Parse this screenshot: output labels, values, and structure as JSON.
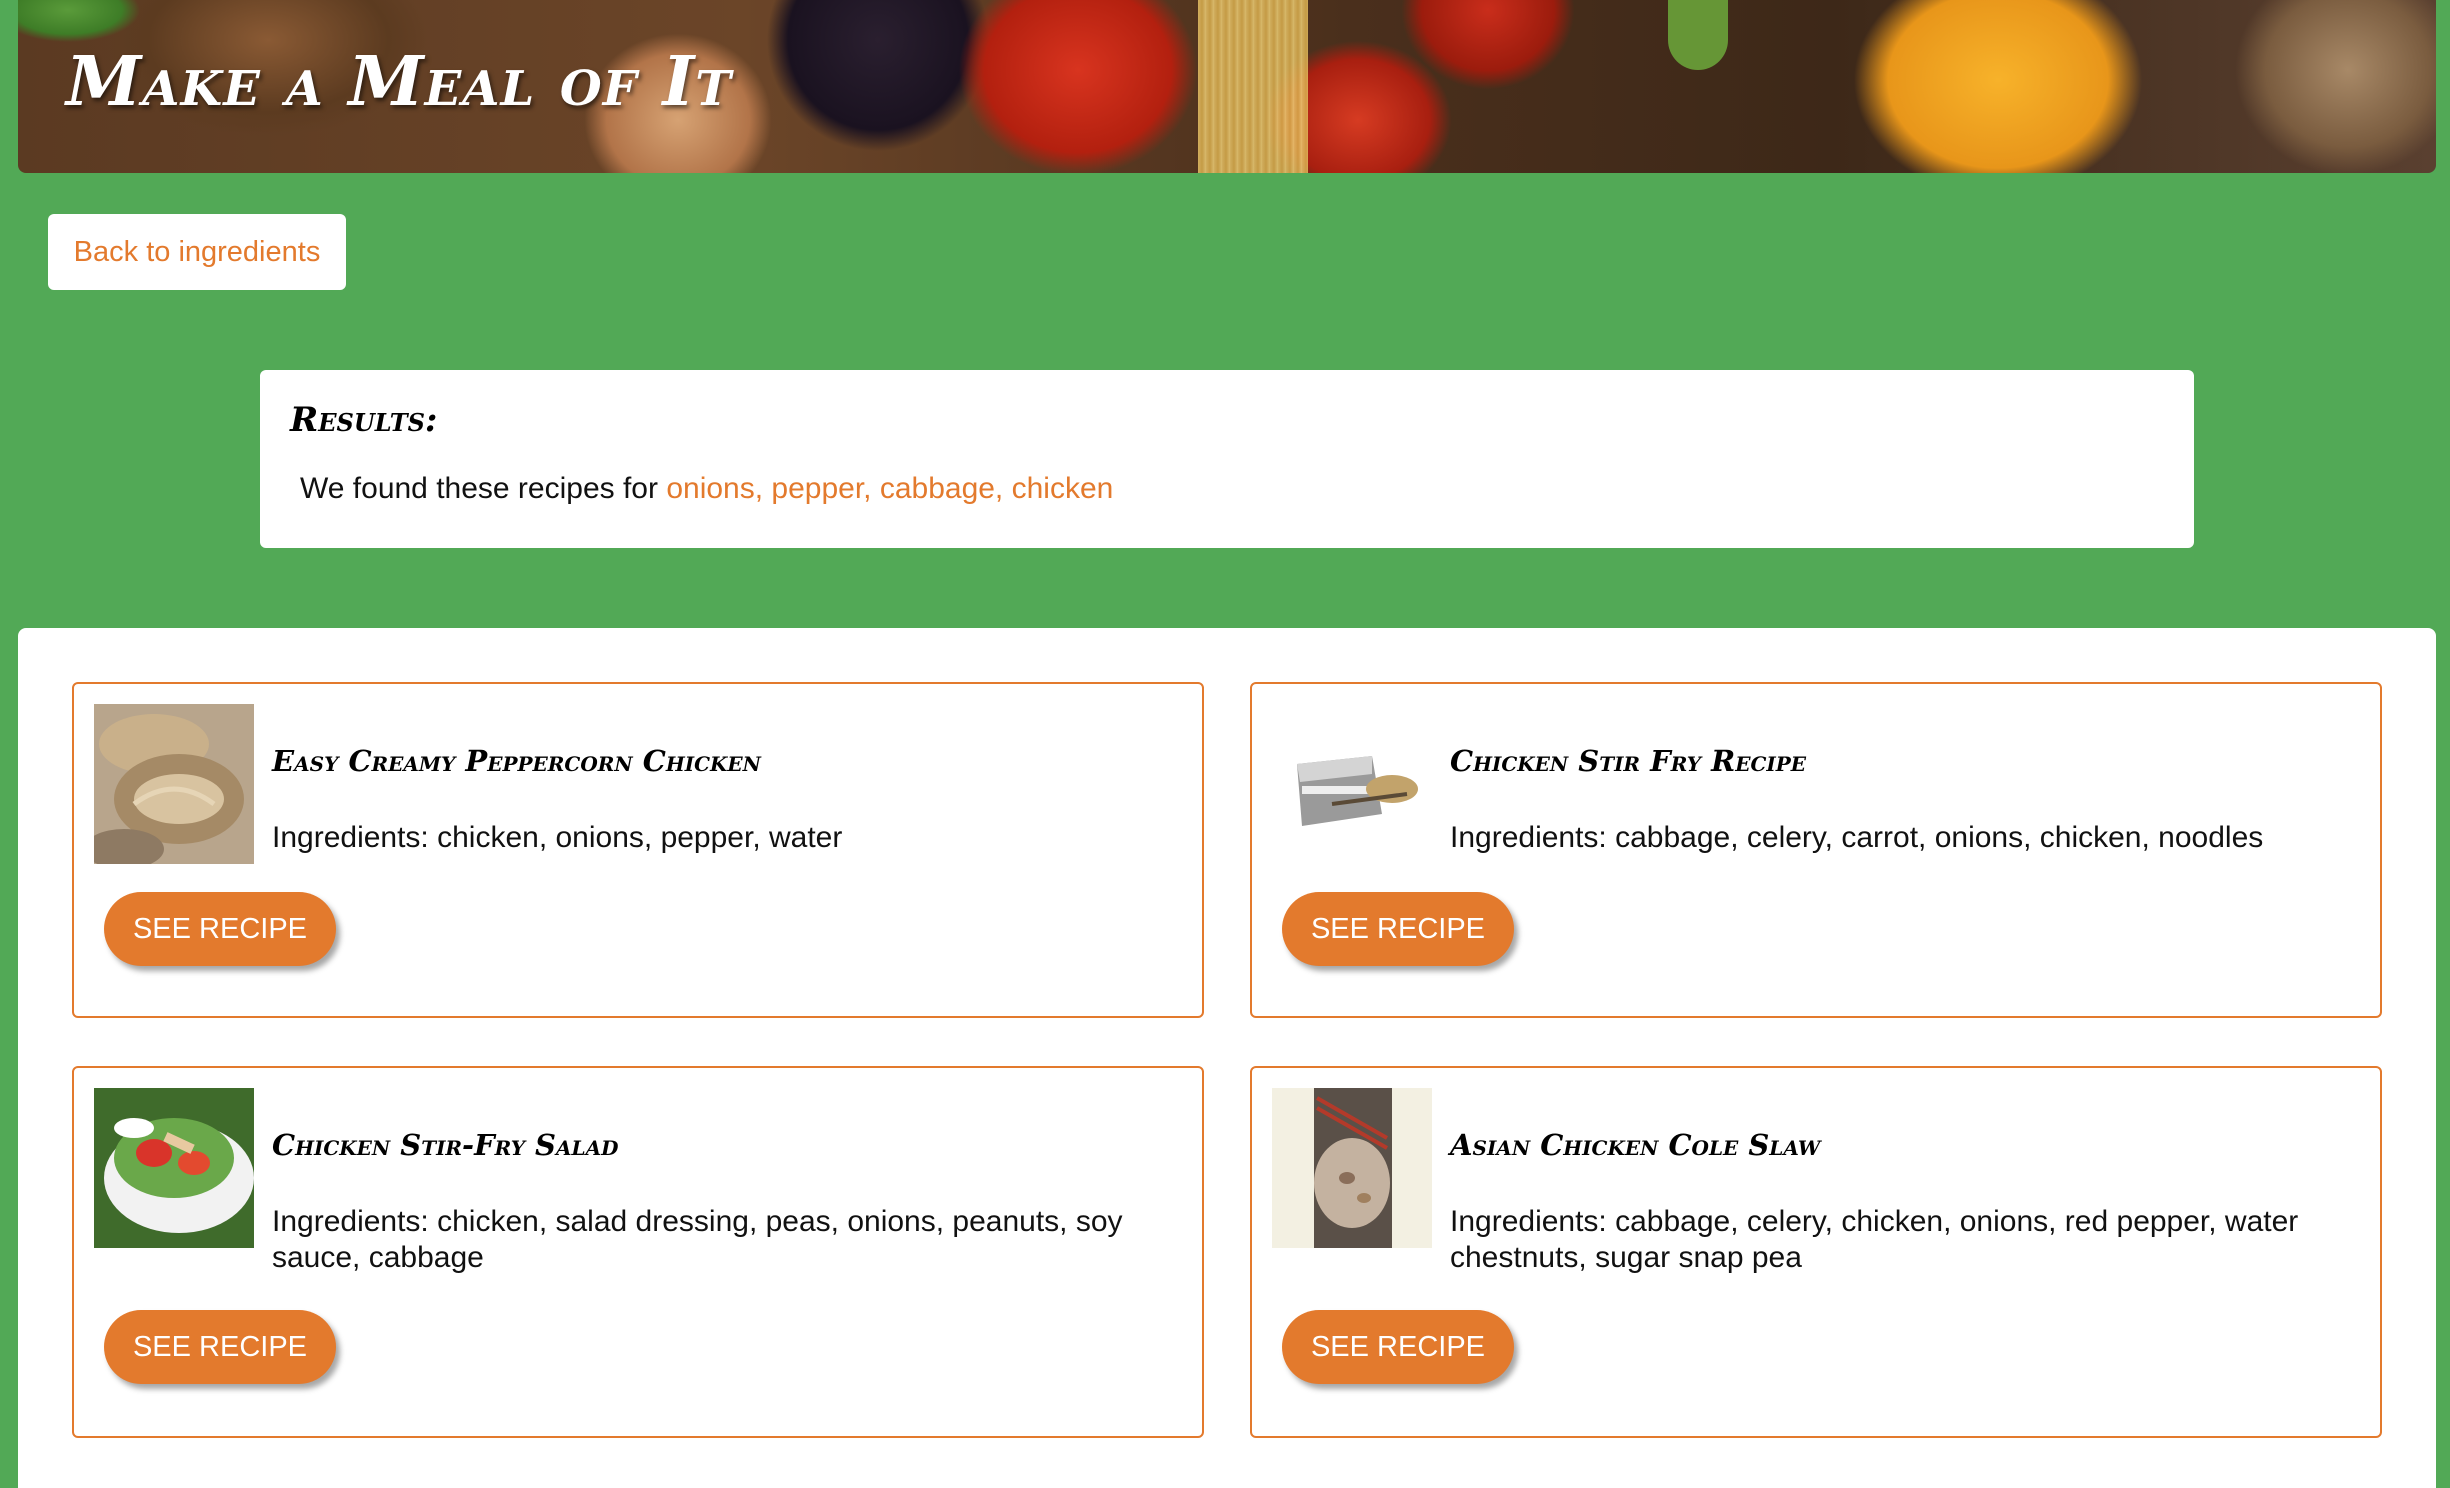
{
  "header": {
    "title": "Make a Meal of It"
  },
  "nav": {
    "back_label": "Back to ingredients"
  },
  "results": {
    "heading": "Results:",
    "intro": "We found these recipes for ",
    "terms": "onions, pepper, cabbage, chicken"
  },
  "recipes": [
    {
      "title": "Easy Creamy Peppercorn Chicken",
      "ingredients": "Ingredients: chicken, onions, pepper, water",
      "button_label": "SEE RECIPE"
    },
    {
      "title": "Chicken Stir Fry Recipe",
      "ingredients": "Ingredients: cabbage, celery, carrot, onions, chicken, noodles",
      "button_label": "SEE RECIPE"
    },
    {
      "title": "Chicken Stir-Fry Salad",
      "ingredients": "Ingredients: chicken, salad dressing, peas, onions, peanuts, soy sauce, cabbage",
      "button_label": "SEE RECIPE"
    },
    {
      "title": "Asian Chicken Cole Slaw",
      "ingredients": "Ingredients: cabbage, celery, chicken, onions, red pepper, water chestnuts, sugar snap pea",
      "button_label": "SEE RECIPE"
    }
  ],
  "colors": {
    "page_background": "#52a956",
    "accent": "#e37a2d",
    "panel": "#ffffff"
  }
}
